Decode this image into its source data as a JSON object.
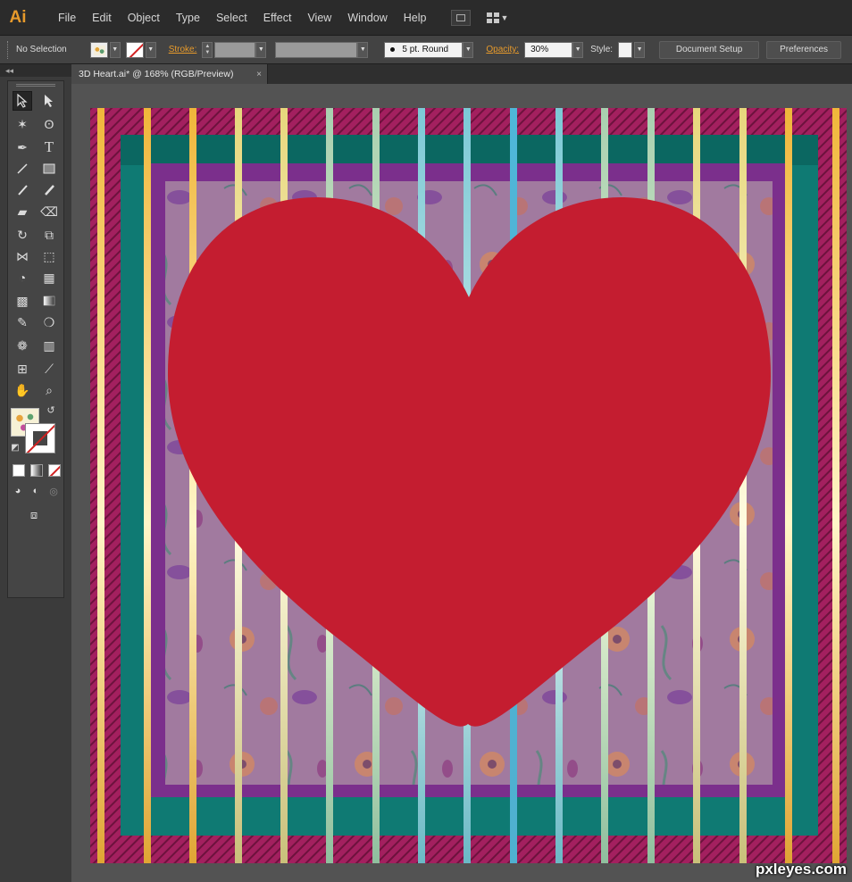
{
  "app": {
    "logo": "Ai"
  },
  "menu": [
    "File",
    "Edit",
    "Object",
    "Type",
    "Select",
    "Effect",
    "View",
    "Window",
    "Help"
  ],
  "control_bar": {
    "selection_label": "No Selection",
    "stroke_label": "Stroke:",
    "brush_label": "5 pt. Round",
    "opacity_label": "Opacity:",
    "opacity_value": "30%",
    "style_label": "Style:",
    "document_setup": "Document Setup",
    "preferences": "Preferences"
  },
  "document": {
    "tab_title": "3D Heart.ai* @ 168% (RGB/Preview)",
    "close_glyph": "×"
  },
  "tools_panel": {
    "collapse_glyph": "◂◂"
  },
  "artwork": {
    "colors": {
      "heart": "#c41d30",
      "outer_frame": "#a3205f",
      "teal_frame": "#0f7a73",
      "purple_frame": "#7b2f8c",
      "pattern_bg": "#a17a9f",
      "bars": [
        "#f0b63a",
        "#e7d77c",
        "#d5df9a",
        "#a9d0b0",
        "#7cc9d6",
        "#4fb6d8"
      ]
    }
  },
  "watermark": "pxleyes.com"
}
